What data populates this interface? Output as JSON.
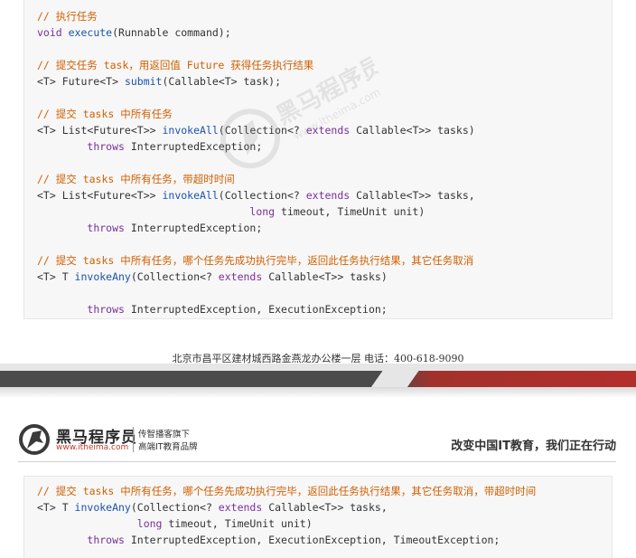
{
  "code_top": [
    [
      {
        "t": "// 执行任务",
        "c": "cm"
      }
    ],
    [
      {
        "t": "void ",
        "c": "kw"
      },
      {
        "t": "execute",
        "c": "fn"
      },
      {
        "t": "(Runnable command);",
        "c": ""
      }
    ],
    [],
    [
      {
        "t": "// 提交任务 task，用返回值 Future 获得任务执行结果",
        "c": "cm"
      }
    ],
    [
      {
        "t": "<T> Future<T> ",
        "c": ""
      },
      {
        "t": "submit",
        "c": "fn"
      },
      {
        "t": "(Callable<T> task);",
        "c": ""
      }
    ],
    [],
    [
      {
        "t": "// 提交 tasks 中所有任务",
        "c": "cm"
      }
    ],
    [
      {
        "t": "<T> List<Future<T>> ",
        "c": ""
      },
      {
        "t": "invokeAll",
        "c": "fn"
      },
      {
        "t": "(Collection<? ",
        "c": ""
      },
      {
        "t": "extends",
        "c": "kw"
      },
      {
        "t": " Callable<T>> tasks)",
        "c": ""
      }
    ],
    [
      {
        "t": "        ",
        "c": ""
      },
      {
        "t": "throws",
        "c": "kw"
      },
      {
        "t": " InterruptedException;",
        "c": ""
      }
    ],
    [],
    [
      {
        "t": "// 提交 tasks 中所有任务，带超时时间",
        "c": "cm"
      }
    ],
    [
      {
        "t": "<T> List<Future<T>> ",
        "c": ""
      },
      {
        "t": "invokeAll",
        "c": "fn"
      },
      {
        "t": "(Collection<? ",
        "c": ""
      },
      {
        "t": "extends",
        "c": "kw"
      },
      {
        "t": " Callable<T>> tasks,",
        "c": ""
      }
    ],
    [
      {
        "t": "                                  ",
        "c": ""
      },
      {
        "t": "long",
        "c": "kw"
      },
      {
        "t": " timeout, TimeUnit unit)",
        "c": ""
      }
    ],
    [
      {
        "t": "        ",
        "c": ""
      },
      {
        "t": "throws",
        "c": "kw"
      },
      {
        "t": " InterruptedException;",
        "c": ""
      }
    ],
    [],
    [
      {
        "t": "// 提交 tasks 中所有任务，哪个任务先成功执行完毕，返回此任务执行结果，其它任务取消",
        "c": "cm"
      }
    ],
    [
      {
        "t": "<T> T ",
        "c": ""
      },
      {
        "t": "invokeAny",
        "c": "fn"
      },
      {
        "t": "(Collection<? ",
        "c": ""
      },
      {
        "t": "extends",
        "c": "kw"
      },
      {
        "t": " Callable<T>> tasks)",
        "c": ""
      }
    ],
    [],
    [
      {
        "t": "        ",
        "c": ""
      },
      {
        "t": "throws",
        "c": "kw"
      },
      {
        "t": " InterruptedException, ExecutionException;",
        "c": ""
      }
    ]
  ],
  "footer": {
    "address": "北京市昌平区建材城西路金燕龙办公楼一层     电话：400-618-9090"
  },
  "header": {
    "brand_name": "黑马程序员",
    "brand_url": "www.itheima.com",
    "tagline_1": "传智播客旗下",
    "tagline_2": "高端IT教育品牌",
    "slogan": "改变中国IT教育，我们正在行动"
  },
  "watermark": {
    "name": "黑马程序员",
    "url": "www.itheima.com"
  },
  "code_bottom": [
    [
      {
        "t": "// 提交 tasks 中所有任务，哪个任务先成功执行完毕，返回此任务执行结果，其它任务取消，带超时时间",
        "c": "cm"
      }
    ],
    [
      {
        "t": "<T> T ",
        "c": ""
      },
      {
        "t": "invokeAny",
        "c": "fn"
      },
      {
        "t": "(Collection<? ",
        "c": ""
      },
      {
        "t": "extends",
        "c": "kw"
      },
      {
        "t": " Callable<T>> tasks,",
        "c": ""
      }
    ],
    [
      {
        "t": "                ",
        "c": ""
      },
      {
        "t": "long",
        "c": "kw"
      },
      {
        "t": " timeout, TimeUnit unit)",
        "c": ""
      }
    ],
    [
      {
        "t": "        ",
        "c": ""
      },
      {
        "t": "throws",
        "c": "kw"
      },
      {
        "t": " InterruptedException, ExecutionException, TimeoutException;",
        "c": ""
      }
    ]
  ]
}
